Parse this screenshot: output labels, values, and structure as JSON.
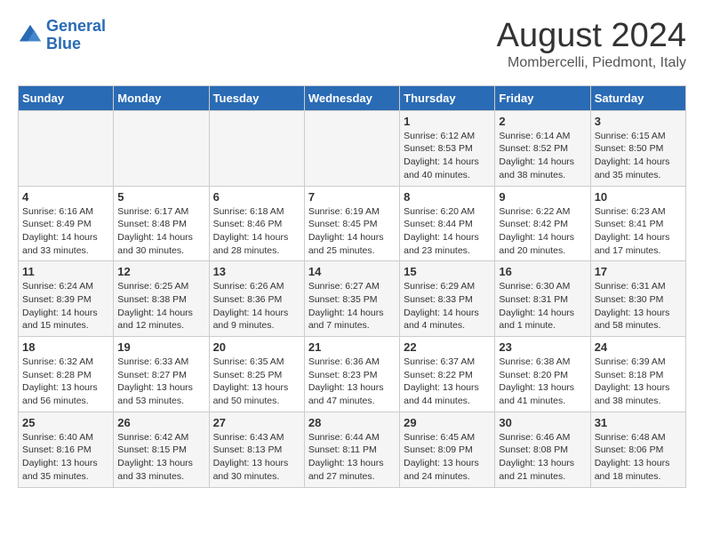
{
  "header": {
    "logo_line1": "General",
    "logo_line2": "Blue",
    "month_title": "August 2024",
    "location": "Mombercelli, Piedmont, Italy"
  },
  "days_of_week": [
    "Sunday",
    "Monday",
    "Tuesday",
    "Wednesday",
    "Thursday",
    "Friday",
    "Saturday"
  ],
  "weeks": [
    [
      {
        "day": "",
        "info": ""
      },
      {
        "day": "",
        "info": ""
      },
      {
        "day": "",
        "info": ""
      },
      {
        "day": "",
        "info": ""
      },
      {
        "day": "1",
        "info": "Sunrise: 6:12 AM\nSunset: 8:53 PM\nDaylight: 14 hours\nand 40 minutes."
      },
      {
        "day": "2",
        "info": "Sunrise: 6:14 AM\nSunset: 8:52 PM\nDaylight: 14 hours\nand 38 minutes."
      },
      {
        "day": "3",
        "info": "Sunrise: 6:15 AM\nSunset: 8:50 PM\nDaylight: 14 hours\nand 35 minutes."
      }
    ],
    [
      {
        "day": "4",
        "info": "Sunrise: 6:16 AM\nSunset: 8:49 PM\nDaylight: 14 hours\nand 33 minutes."
      },
      {
        "day": "5",
        "info": "Sunrise: 6:17 AM\nSunset: 8:48 PM\nDaylight: 14 hours\nand 30 minutes."
      },
      {
        "day": "6",
        "info": "Sunrise: 6:18 AM\nSunset: 8:46 PM\nDaylight: 14 hours\nand 28 minutes."
      },
      {
        "day": "7",
        "info": "Sunrise: 6:19 AM\nSunset: 8:45 PM\nDaylight: 14 hours\nand 25 minutes."
      },
      {
        "day": "8",
        "info": "Sunrise: 6:20 AM\nSunset: 8:44 PM\nDaylight: 14 hours\nand 23 minutes."
      },
      {
        "day": "9",
        "info": "Sunrise: 6:22 AM\nSunset: 8:42 PM\nDaylight: 14 hours\nand 20 minutes."
      },
      {
        "day": "10",
        "info": "Sunrise: 6:23 AM\nSunset: 8:41 PM\nDaylight: 14 hours\nand 17 minutes."
      }
    ],
    [
      {
        "day": "11",
        "info": "Sunrise: 6:24 AM\nSunset: 8:39 PM\nDaylight: 14 hours\nand 15 minutes."
      },
      {
        "day": "12",
        "info": "Sunrise: 6:25 AM\nSunset: 8:38 PM\nDaylight: 14 hours\nand 12 minutes."
      },
      {
        "day": "13",
        "info": "Sunrise: 6:26 AM\nSunset: 8:36 PM\nDaylight: 14 hours\nand 9 minutes."
      },
      {
        "day": "14",
        "info": "Sunrise: 6:27 AM\nSunset: 8:35 PM\nDaylight: 14 hours\nand 7 minutes."
      },
      {
        "day": "15",
        "info": "Sunrise: 6:29 AM\nSunset: 8:33 PM\nDaylight: 14 hours\nand 4 minutes."
      },
      {
        "day": "16",
        "info": "Sunrise: 6:30 AM\nSunset: 8:31 PM\nDaylight: 14 hours\nand 1 minute."
      },
      {
        "day": "17",
        "info": "Sunrise: 6:31 AM\nSunset: 8:30 PM\nDaylight: 13 hours\nand 58 minutes."
      }
    ],
    [
      {
        "day": "18",
        "info": "Sunrise: 6:32 AM\nSunset: 8:28 PM\nDaylight: 13 hours\nand 56 minutes."
      },
      {
        "day": "19",
        "info": "Sunrise: 6:33 AM\nSunset: 8:27 PM\nDaylight: 13 hours\nand 53 minutes."
      },
      {
        "day": "20",
        "info": "Sunrise: 6:35 AM\nSunset: 8:25 PM\nDaylight: 13 hours\nand 50 minutes."
      },
      {
        "day": "21",
        "info": "Sunrise: 6:36 AM\nSunset: 8:23 PM\nDaylight: 13 hours\nand 47 minutes."
      },
      {
        "day": "22",
        "info": "Sunrise: 6:37 AM\nSunset: 8:22 PM\nDaylight: 13 hours\nand 44 minutes."
      },
      {
        "day": "23",
        "info": "Sunrise: 6:38 AM\nSunset: 8:20 PM\nDaylight: 13 hours\nand 41 minutes."
      },
      {
        "day": "24",
        "info": "Sunrise: 6:39 AM\nSunset: 8:18 PM\nDaylight: 13 hours\nand 38 minutes."
      }
    ],
    [
      {
        "day": "25",
        "info": "Sunrise: 6:40 AM\nSunset: 8:16 PM\nDaylight: 13 hours\nand 35 minutes."
      },
      {
        "day": "26",
        "info": "Sunrise: 6:42 AM\nSunset: 8:15 PM\nDaylight: 13 hours\nand 33 minutes."
      },
      {
        "day": "27",
        "info": "Sunrise: 6:43 AM\nSunset: 8:13 PM\nDaylight: 13 hours\nand 30 minutes."
      },
      {
        "day": "28",
        "info": "Sunrise: 6:44 AM\nSunset: 8:11 PM\nDaylight: 13 hours\nand 27 minutes."
      },
      {
        "day": "29",
        "info": "Sunrise: 6:45 AM\nSunset: 8:09 PM\nDaylight: 13 hours\nand 24 minutes."
      },
      {
        "day": "30",
        "info": "Sunrise: 6:46 AM\nSunset: 8:08 PM\nDaylight: 13 hours\nand 21 minutes."
      },
      {
        "day": "31",
        "info": "Sunrise: 6:48 AM\nSunset: 8:06 PM\nDaylight: 13 hours\nand 18 minutes."
      }
    ]
  ]
}
